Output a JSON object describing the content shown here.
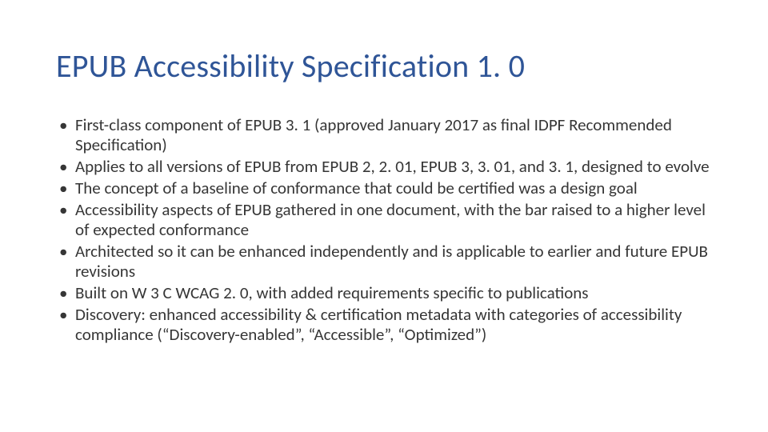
{
  "slide": {
    "title": "EPUB Accessibility Specification 1. 0",
    "bullets": [
      "First-class component of EPUB 3. 1 (approved January 2017 as final IDPF Recommended Specification)",
      "Applies to all versions of EPUB from EPUB 2, 2. 01, EPUB 3, 3. 01, and 3. 1, designed to evolve",
      "The concept of a baseline of conformance that could be certified was a design goal",
      "Accessibility aspects of EPUB gathered in one document, with the bar raised to a higher level of expected conformance",
      "Architected so it can be enhanced independently and is applicable to earlier and future EPUB revisions",
      "Built on W 3 C WCAG 2. 0, with added requirements specific to publications",
      "Discovery: enhanced accessibility & certification metadata with categories of accessibility compliance (“Discovery-enabled”, “Accessible”, “Optimized”)"
    ]
  }
}
